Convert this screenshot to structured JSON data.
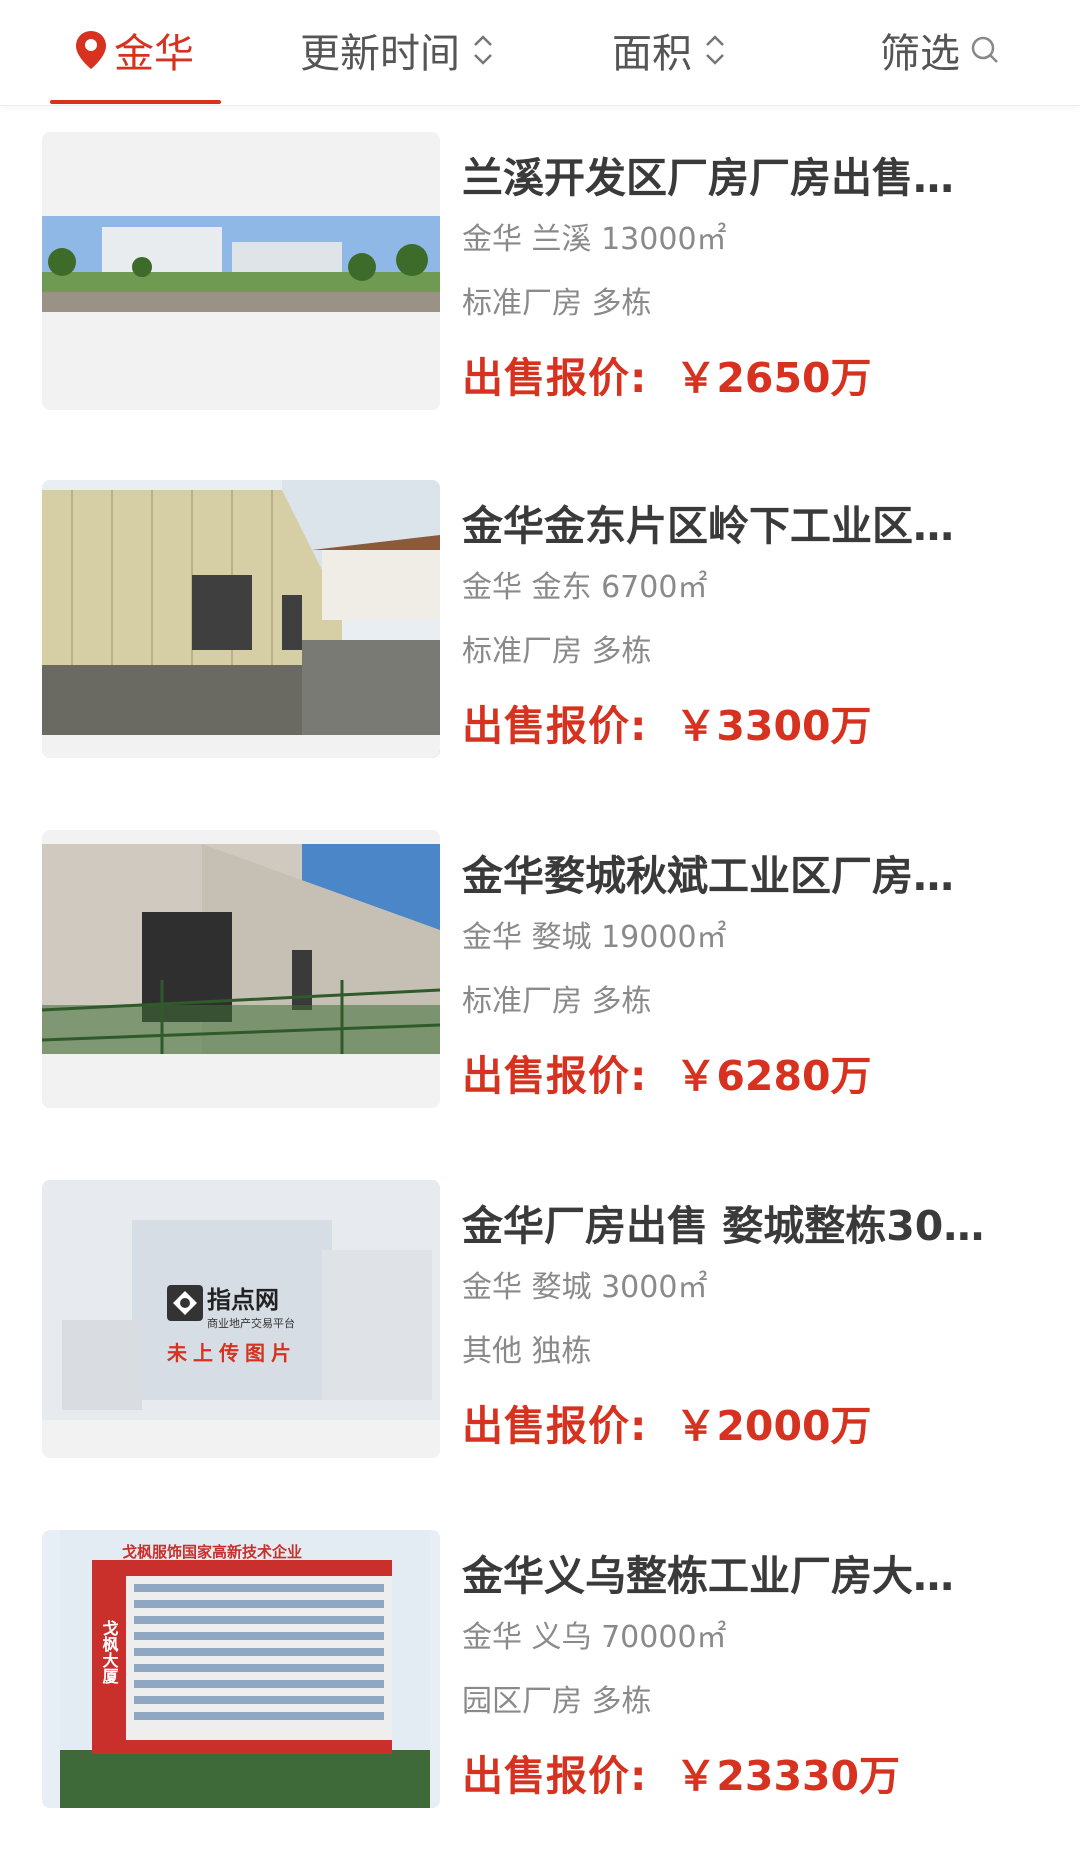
{
  "header": {
    "location": "金华",
    "sort_update": "更新时间",
    "sort_area": "面积",
    "filter": "筛选"
  },
  "listings": [
    {
      "title": "兰溪开发区厂房厂房出售…",
      "city": "金华",
      "district": "兰溪",
      "area": "13000㎡",
      "type": "标准厂房",
      "building": "多栋",
      "price_label": "出售报价:",
      "price": "￥2650万"
    },
    {
      "title": "金华金东片区岭下工业区…",
      "city": "金华",
      "district": "金东",
      "area": "6700㎡",
      "type": "标准厂房",
      "building": "多栋",
      "price_label": "出售报价:",
      "price": "￥3300万"
    },
    {
      "title": "金华婺城秋斌工业区厂房…",
      "city": "金华",
      "district": "婺城",
      "area": "19000㎡",
      "type": "标准厂房",
      "building": "多栋",
      "price_label": "出售报价:",
      "price": "￥6280万"
    },
    {
      "title": "金华厂房出售 婺城整栋30…",
      "city": "金华",
      "district": "婺城",
      "area": "3000㎡",
      "type": "其他",
      "building": "独栋",
      "price_label": "出售报价:",
      "price": "￥2000万",
      "placeholder_brand": "指点网",
      "placeholder_tagline": "商业地产交易平台",
      "placeholder_note": "未上传图片"
    },
    {
      "title": "金华义乌整栋工业厂房大…",
      "city": "金华",
      "district": "义乌",
      "area": "70000㎡",
      "type": "园区厂房",
      "building": "多栋",
      "price_label": "出售报价:",
      "price": "￥23330万",
      "sign_text": "戈枫服饰国家高新技术企业",
      "tower_text": "戈枫大厦"
    }
  ],
  "colors": {
    "accent": "#d6321f",
    "title": "#3a3a3a",
    "meta": "#8a8a8a"
  }
}
